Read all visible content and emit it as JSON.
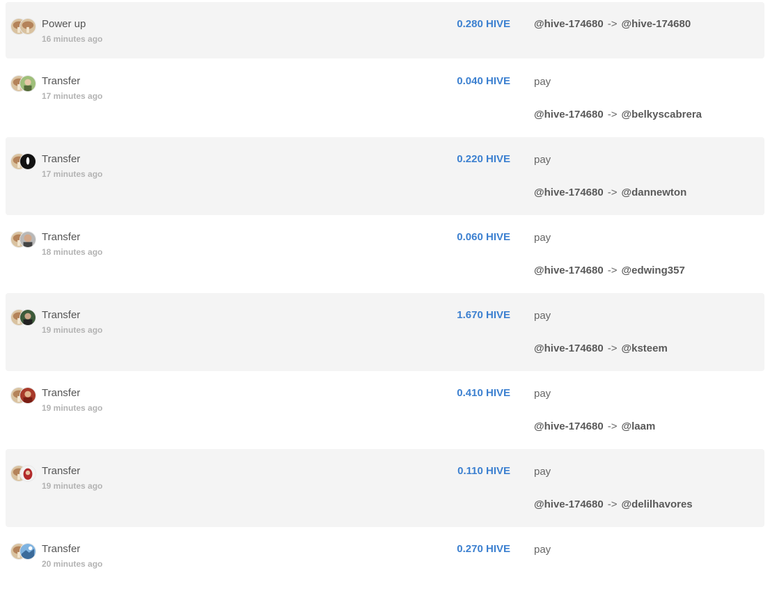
{
  "operations": [
    {
      "title": "Power up",
      "time": "16 minutes ago",
      "amount": "0.280 HIVE",
      "memo": "",
      "from": "@hive-174680",
      "arrow": "->",
      "to": "@hive-174680",
      "avatar2": "mushroom"
    },
    {
      "title": "Transfer",
      "time": "17 minutes ago",
      "amount": "0.040 HIVE",
      "memo": "pay",
      "from": "@hive-174680",
      "arrow": "->",
      "to": "@belkyscabrera",
      "avatar2": "green"
    },
    {
      "title": "Transfer",
      "time": "17 minutes ago",
      "amount": "0.220 HIVE",
      "memo": "pay",
      "from": "@hive-174680",
      "arrow": "->",
      "to": "@dannewton",
      "avatar2": "black"
    },
    {
      "title": "Transfer",
      "time": "18 minutes ago",
      "amount": "0.060 HIVE",
      "memo": "pay",
      "from": "@hive-174680",
      "arrow": "->",
      "to": "@edwing357",
      "avatar2": "face"
    },
    {
      "title": "Transfer",
      "time": "19 minutes ago",
      "amount": "1.670 HIVE",
      "memo": "pay",
      "from": "@hive-174680",
      "arrow": "->",
      "to": "@ksteem",
      "avatar2": "dark"
    },
    {
      "title": "Transfer",
      "time": "19 minutes ago",
      "amount": "0.410 HIVE",
      "memo": "pay",
      "from": "@hive-174680",
      "arrow": "->",
      "to": "@laam",
      "avatar2": "red"
    },
    {
      "title": "Transfer",
      "time": "19 minutes ago",
      "amount": "0.110 HIVE",
      "memo": "pay",
      "from": "@hive-174680",
      "arrow": "->",
      "to": "@delilhavores",
      "avatar2": "hijab"
    },
    {
      "title": "Transfer",
      "time": "20 minutes ago",
      "amount": "0.270 HIVE",
      "memo": "pay",
      "from": "@hive-174680",
      "arrow": "->",
      "to": "",
      "avatar2": "sky"
    }
  ],
  "colors": {
    "amount": "#3c80d0",
    "shaded_row": "#f4f4f4",
    "muted_text": "#b3b3b3"
  }
}
